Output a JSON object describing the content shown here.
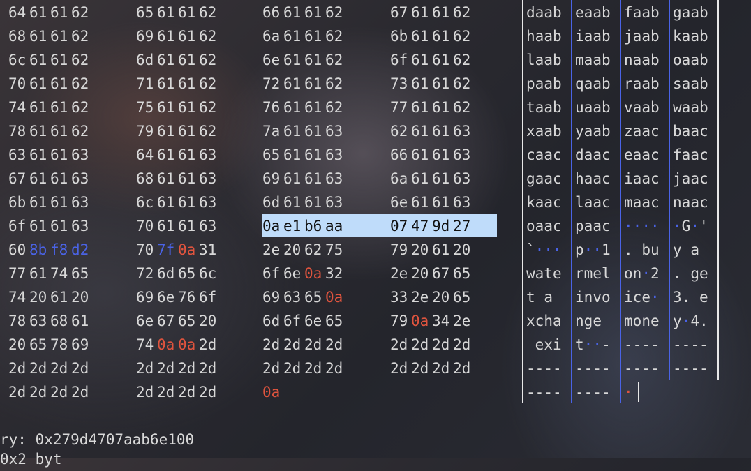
{
  "hex_rows": [
    [
      [
        "64",
        "61",
        "61",
        "62"
      ],
      [
        "65",
        "61",
        "61",
        "62"
      ],
      [
        "66",
        "61",
        "61",
        "62"
      ],
      [
        "67",
        "61",
        "61",
        "62"
      ]
    ],
    [
      [
        "68",
        "61",
        "61",
        "62"
      ],
      [
        "69",
        "61",
        "61",
        "62"
      ],
      [
        "6a",
        "61",
        "61",
        "62"
      ],
      [
        "6b",
        "61",
        "61",
        "62"
      ]
    ],
    [
      [
        "6c",
        "61",
        "61",
        "62"
      ],
      [
        "6d",
        "61",
        "61",
        "62"
      ],
      [
        "6e",
        "61",
        "61",
        "62"
      ],
      [
        "6f",
        "61",
        "61",
        "62"
      ]
    ],
    [
      [
        "70",
        "61",
        "61",
        "62"
      ],
      [
        "71",
        "61",
        "61",
        "62"
      ],
      [
        "72",
        "61",
        "61",
        "62"
      ],
      [
        "73",
        "61",
        "61",
        "62"
      ]
    ],
    [
      [
        "74",
        "61",
        "61",
        "62"
      ],
      [
        "75",
        "61",
        "61",
        "62"
      ],
      [
        "76",
        "61",
        "61",
        "62"
      ],
      [
        "77",
        "61",
        "61",
        "62"
      ]
    ],
    [
      [
        "78",
        "61",
        "61",
        "62"
      ],
      [
        "79",
        "61",
        "61",
        "62"
      ],
      [
        "7a",
        "61",
        "61",
        "63"
      ],
      [
        "62",
        "61",
        "61",
        "63"
      ]
    ],
    [
      [
        "63",
        "61",
        "61",
        "63"
      ],
      [
        "64",
        "61",
        "61",
        "63"
      ],
      [
        "65",
        "61",
        "61",
        "63"
      ],
      [
        "66",
        "61",
        "61",
        "63"
      ]
    ],
    [
      [
        "67",
        "61",
        "61",
        "63"
      ],
      [
        "68",
        "61",
        "61",
        "63"
      ],
      [
        "69",
        "61",
        "61",
        "63"
      ],
      [
        "6a",
        "61",
        "61",
        "63"
      ]
    ],
    [
      [
        "6b",
        "61",
        "61",
        "63"
      ],
      [
        "6c",
        "61",
        "61",
        "63"
      ],
      [
        "6d",
        "61",
        "61",
        "63"
      ],
      [
        "6e",
        "61",
        "61",
        "63"
      ]
    ],
    [
      [
        "6f",
        "61",
        "61",
        "63"
      ],
      [
        "70",
        "61",
        "61",
        "63"
      ],
      [
        "0a",
        "e1",
        "b6",
        "aa"
      ],
      [
        "07",
        "47",
        "9d",
        "27"
      ]
    ],
    [
      [
        "60",
        "8b",
        "f8",
        "d2"
      ],
      [
        "70",
        "7f",
        "0a",
        "31"
      ],
      [
        "2e",
        "20",
        "62",
        "75"
      ],
      [
        "79",
        "20",
        "61",
        "20"
      ]
    ],
    [
      [
        "77",
        "61",
        "74",
        "65"
      ],
      [
        "72",
        "6d",
        "65",
        "6c"
      ],
      [
        "6f",
        "6e",
        "0a",
        "32"
      ],
      [
        "2e",
        "20",
        "67",
        "65"
      ]
    ],
    [
      [
        "74",
        "20",
        "61",
        "20"
      ],
      [
        "69",
        "6e",
        "76",
        "6f"
      ],
      [
        "69",
        "63",
        "65",
        "0a"
      ],
      [
        "33",
        "2e",
        "20",
        "65"
      ]
    ],
    [
      [
        "78",
        "63",
        "68",
        "61"
      ],
      [
        "6e",
        "67",
        "65",
        "20"
      ],
      [
        "6d",
        "6f",
        "6e",
        "65"
      ],
      [
        "79",
        "0a",
        "34",
        "2e"
      ]
    ],
    [
      [
        "20",
        "65",
        "78",
        "69"
      ],
      [
        "74",
        "0a",
        "0a",
        "2d"
      ],
      [
        "2d",
        "2d",
        "2d",
        "2d"
      ],
      [
        "2d",
        "2d",
        "2d",
        "2d"
      ]
    ],
    [
      [
        "2d",
        "2d",
        "2d",
        "2d"
      ],
      [
        "2d",
        "2d",
        "2d",
        "2d"
      ],
      [
        "2d",
        "2d",
        "2d",
        "2d"
      ],
      [
        "2d",
        "2d",
        "2d",
        "2d"
      ]
    ],
    [
      [
        "2d",
        "2d",
        "2d",
        "2d"
      ],
      [
        "2d",
        "2d",
        "2d",
        "2d"
      ],
      [
        "0a"
      ]
    ]
  ],
  "ascii_rows": [
    [
      "daab",
      "eaab",
      "faab",
      "gaab"
    ],
    [
      "haab",
      "iaab",
      "jaab",
      "kaab"
    ],
    [
      "laab",
      "maab",
      "naab",
      "oaab"
    ],
    [
      "paab",
      "qaab",
      "raab",
      "saab"
    ],
    [
      "taab",
      "uaab",
      "vaab",
      "waab"
    ],
    [
      "xaab",
      "yaab",
      "zaac",
      "baac"
    ],
    [
      "caac",
      "daac",
      "eaac",
      "faac"
    ],
    [
      "gaac",
      "haac",
      "iaac",
      "jaac"
    ],
    [
      "kaac",
      "laac",
      "maac",
      "naac"
    ],
    [
      "oaac",
      "paac",
      "····",
      "·G·'"
    ],
    [
      "`···",
      "p··1",
      ". bu",
      "y a "
    ],
    [
      "wate",
      "rmel",
      "on·2",
      ". ge"
    ],
    [
      "t a ",
      "invo",
      "ice·",
      "3. e"
    ],
    [
      "xcha",
      "nge ",
      "mone",
      "y·4."
    ],
    [
      " exi",
      "t··-",
      "----",
      "----"
    ],
    [
      "----",
      "----",
      "----",
      "----"
    ],
    [
      "----",
      "----",
      "·"
    ]
  ],
  "status": {
    "entry_text": "ry: 0x279d4707aab6e100",
    "next_line_text": "0x2 byt"
  },
  "colors": {
    "newline_byte": "#e0543e",
    "nonprint_byte": "#4a63e6",
    "selection_bg": "#bfdcfa",
    "divider": "#e8e8e8",
    "column_divider": "#4a63e6"
  }
}
